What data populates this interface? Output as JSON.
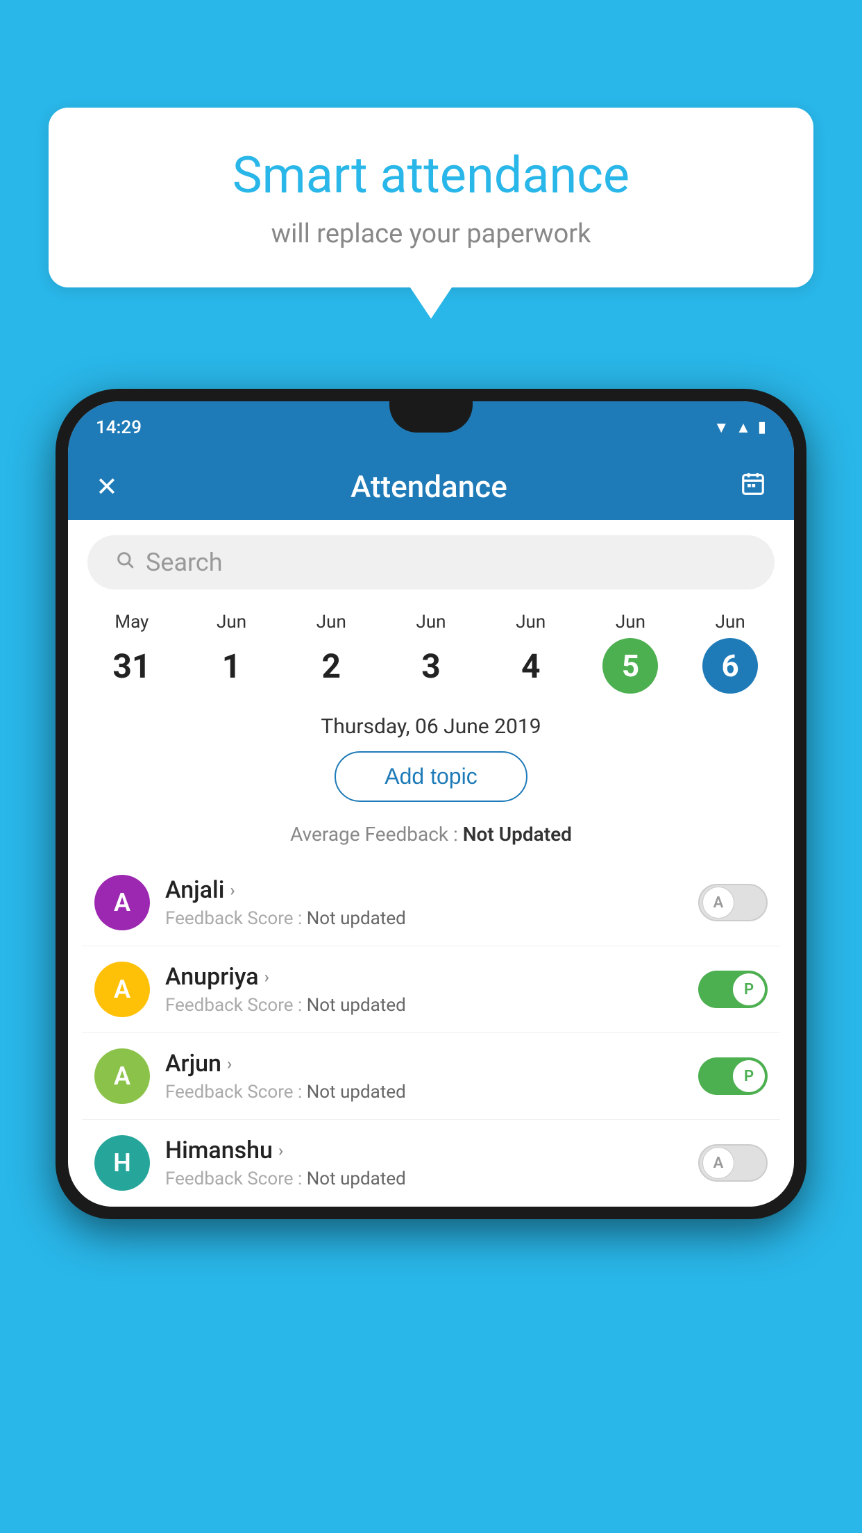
{
  "background_color": "#29b6e8",
  "bubble": {
    "title": "Smart attendance",
    "subtitle": "will replace your paperwork"
  },
  "status_bar": {
    "time": "14:29",
    "wifi_icon": "▼",
    "signal_icon": "▲",
    "battery_icon": "▮"
  },
  "header": {
    "close_icon": "✕",
    "title": "Attendance",
    "calendar_icon": "📅"
  },
  "search": {
    "placeholder": "Search",
    "icon": "🔍"
  },
  "dates": [
    {
      "month": "May",
      "day": "31",
      "state": "normal"
    },
    {
      "month": "Jun",
      "day": "1",
      "state": "normal"
    },
    {
      "month": "Jun",
      "day": "2",
      "state": "normal"
    },
    {
      "month": "Jun",
      "day": "3",
      "state": "normal"
    },
    {
      "month": "Jun",
      "day": "4",
      "state": "normal"
    },
    {
      "month": "Jun",
      "day": "5",
      "state": "today"
    },
    {
      "month": "Jun",
      "day": "6",
      "state": "selected"
    }
  ],
  "selected_date_label": "Thursday, 06 June 2019",
  "add_topic_label": "Add topic",
  "avg_feedback_label": "Average Feedback :",
  "avg_feedback_value": "Not Updated",
  "students": [
    {
      "name": "Anjali",
      "initial": "A",
      "avatar_color": "purple",
      "feedback_label": "Feedback Score :",
      "feedback_value": "Not updated",
      "toggle": "off",
      "toggle_label": "A"
    },
    {
      "name": "Anupriya",
      "initial": "A",
      "avatar_color": "amber",
      "feedback_label": "Feedback Score :",
      "feedback_value": "Not updated",
      "toggle": "on",
      "toggle_label": "P"
    },
    {
      "name": "Arjun",
      "initial": "A",
      "avatar_color": "lightgreen",
      "feedback_label": "Feedback Score :",
      "feedback_value": "Not updated",
      "toggle": "on",
      "toggle_label": "P"
    },
    {
      "name": "Himanshu",
      "initial": "H",
      "avatar_color": "teal",
      "feedback_label": "Feedback Score :",
      "feedback_value": "Not updated",
      "toggle": "off",
      "toggle_label": "A"
    }
  ]
}
